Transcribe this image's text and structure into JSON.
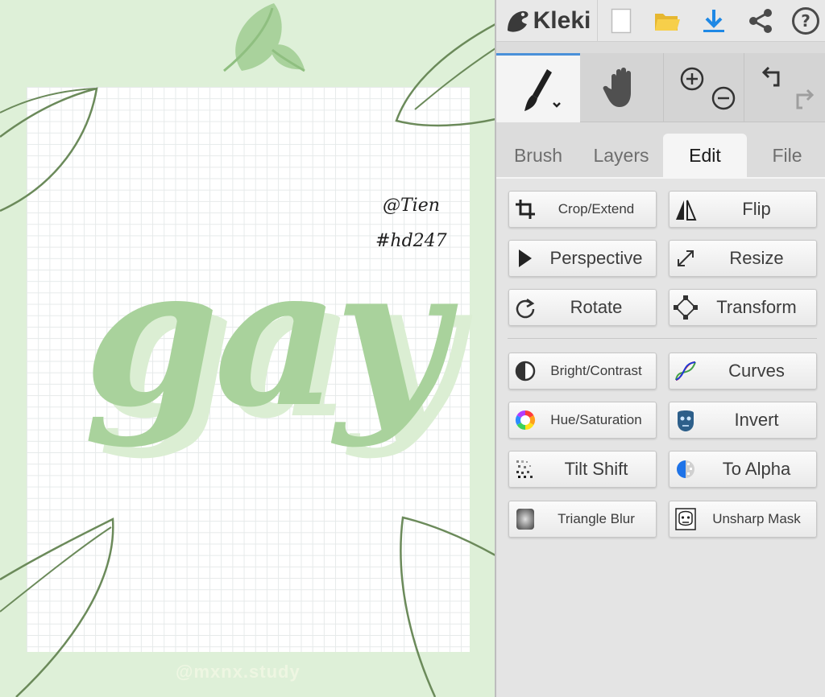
{
  "canvas": {
    "author_tag": "@Tien",
    "hashtag": "#hd247",
    "big_word": "gay",
    "watermark": "@mxnx.study"
  },
  "topbar": {
    "logo_text": "Kleki",
    "icons": [
      "kleki-logo-icon",
      "new-image-icon",
      "open-folder-icon",
      "download-icon",
      "share-icon",
      "help-icon"
    ]
  },
  "tools": {
    "icons": [
      "brush-icon",
      "hand-icon",
      "zoom-in-icon",
      "zoom-out-icon",
      "undo-icon",
      "redo-icon"
    ]
  },
  "tabs": [
    {
      "label": "Brush"
    },
    {
      "label": "Layers"
    },
    {
      "label": "Edit",
      "active": true
    },
    {
      "label": "File"
    }
  ],
  "edit": {
    "buttons": [
      {
        "label": "Crop/Extend",
        "icon": "crop-icon"
      },
      {
        "label": "Flip",
        "icon": "flip-icon"
      },
      {
        "label": "Perspective",
        "icon": "perspective-icon"
      },
      {
        "label": "Resize",
        "icon": "resize-icon"
      },
      {
        "label": "Rotate",
        "icon": "rotate-icon"
      },
      {
        "label": "Transform",
        "icon": "transform-icon"
      },
      {
        "label": "Bright/Contrast",
        "icon": "brightness-contrast-icon"
      },
      {
        "label": "Curves",
        "icon": "curves-icon"
      },
      {
        "label": "Hue/Saturation",
        "icon": "hue-saturation-icon"
      },
      {
        "label": "Invert",
        "icon": "invert-icon"
      },
      {
        "label": "Tilt Shift",
        "icon": "tilt-shift-icon"
      },
      {
        "label": "To Alpha",
        "icon": "to-alpha-icon"
      },
      {
        "label": "Triangle Blur",
        "icon": "triangle-blur-icon"
      },
      {
        "label": "Unsharp Mask",
        "icon": "unsharp-mask-icon"
      }
    ]
  },
  "colors": {
    "canvas_bg": "#def0d8",
    "leaf_fill": "#a9d29c",
    "leaf_stroke": "#6b8a5a",
    "accent_blue": "#1e88e5",
    "panel_bg": "#dcdcdc"
  }
}
